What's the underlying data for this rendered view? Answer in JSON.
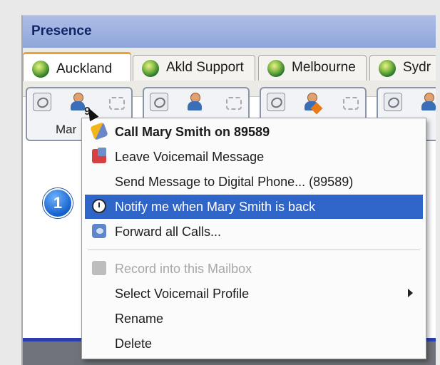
{
  "window": {
    "title": "Presence"
  },
  "tabs": [
    {
      "label": "Auckland",
      "active": true
    },
    {
      "label": "Akld Support",
      "active": false
    },
    {
      "label": "Melbourne",
      "active": false
    },
    {
      "label": "Sydr",
      "active": false
    }
  ],
  "presence_boxes": [
    {
      "name_visible": "Mar",
      "status_badge": "clock"
    },
    {
      "name_visible": "",
      "status_badge": "none"
    },
    {
      "name_visible": "",
      "status_badge": "star"
    },
    {
      "name_visible": "",
      "status_badge": "none"
    }
  ],
  "step_badge": "1",
  "context_menu": {
    "items": [
      {
        "label": "Call Mary Smith on 89589",
        "bold": true,
        "icon": "phone-call-icon"
      },
      {
        "label": "Leave Voicemail Message",
        "icon": "voicemail-icon"
      },
      {
        "label": "Send Message to Digital Phone... (89589)"
      },
      {
        "label": "Notify me when Mary Smith is back",
        "highlighted": true,
        "icon": "clock-icon"
      },
      {
        "label": "Forward all Calls...",
        "icon": "forward-icon"
      },
      {
        "label": "Record into this Mailbox",
        "disabled": true,
        "icon": "record-icon"
      },
      {
        "label": "Select Voicemail Profile",
        "submenu": true
      },
      {
        "label": "Rename"
      },
      {
        "label": "Delete"
      }
    ]
  },
  "colors": {
    "titlebar": "#9fb2e0",
    "title_text": "#10246a",
    "highlight": "#2f64c8",
    "tab_active_accent": "#f0a030"
  }
}
